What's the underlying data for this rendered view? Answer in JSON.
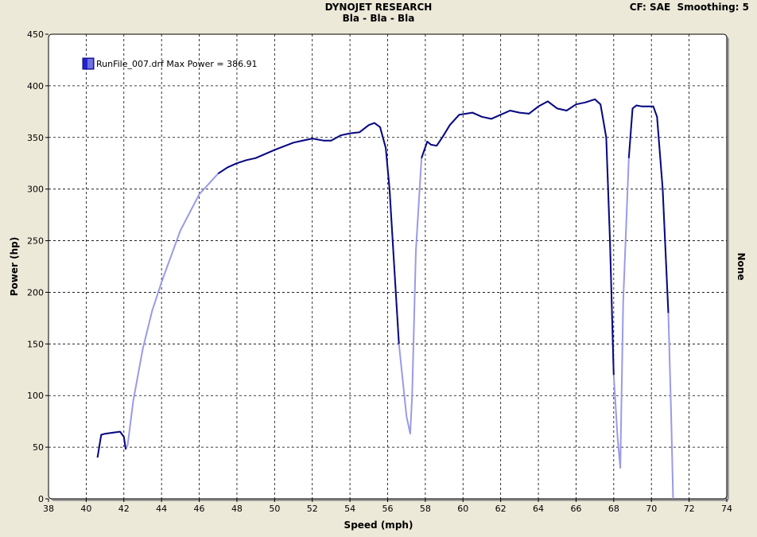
{
  "header": {
    "title": "DYNOJET RESEARCH",
    "subtitle": "Bla - Bla - Bla",
    "correction": "CF: SAE",
    "smoothing": "Smoothing: 5"
  },
  "right_label": "None",
  "chart_data": {
    "type": "line",
    "xlabel": "Speed (mph)",
    "ylabel": "Power (hp)",
    "xlim": [
      38,
      74
    ],
    "ylim": [
      0,
      450
    ],
    "xticks": [
      38,
      40,
      42,
      44,
      46,
      48,
      50,
      52,
      54,
      56,
      58,
      60,
      62,
      64,
      66,
      68,
      70,
      72,
      74
    ],
    "yticks": [
      0,
      50,
      100,
      150,
      200,
      250,
      300,
      350,
      400,
      450
    ],
    "grid": true,
    "legend_position": "top-left",
    "colors": {
      "line_dark": "#0a0a80",
      "line_light": "#9a9ae8",
      "plot_bg": "#ffffff",
      "window_bg": "#ece9d8"
    },
    "series": [
      {
        "name": "RunFile_007.drf Max Power = 386.91",
        "x": [
          40.6,
          40.8,
          41.0,
          41.4,
          41.8,
          42.0,
          42.1,
          42.2,
          42.5,
          43.0,
          43.5,
          44.0,
          45.0,
          46.0,
          47.0,
          47.5,
          48.0,
          48.5,
          49.0,
          50.0,
          51.0,
          52.0,
          52.6,
          53.0,
          53.5,
          54.0,
          54.5,
          55.0,
          55.3,
          55.6,
          55.9,
          56.1,
          56.3,
          56.6,
          57.0,
          57.2,
          57.3,
          57.5,
          57.8,
          58.1,
          58.3,
          58.6,
          58.9,
          59.3,
          59.8,
          60.5,
          61.0,
          61.5,
          62.0,
          62.5,
          63.0,
          63.5,
          64.0,
          64.5,
          65.0,
          65.5,
          66.0,
          66.5,
          67.0,
          67.3,
          67.6,
          67.8,
          68.0,
          68.2,
          68.35,
          68.5,
          68.8,
          69.0,
          69.2,
          69.5,
          69.8,
          70.1,
          70.3,
          70.6,
          70.9,
          71.05,
          71.15
        ],
        "y": [
          40,
          62,
          63,
          64,
          65,
          60,
          48,
          52,
          95,
          145,
          182,
          210,
          260,
          295,
          315,
          321,
          325,
          328,
          330,
          338,
          345,
          349,
          347,
          347,
          352,
          354,
          355,
          362,
          364,
          360,
          340,
          300,
          240,
          150,
          80,
          63,
          100,
          240,
          330,
          346,
          343,
          342,
          350,
          362,
          372,
          374,
          370,
          368,
          372,
          376,
          374,
          373,
          380,
          385,
          378,
          376,
          382,
          384,
          387,
          382,
          350,
          250,
          120,
          60,
          30,
          190,
          330,
          378,
          381,
          380,
          380,
          380,
          370,
          300,
          180,
          80,
          0
        ]
      }
    ]
  }
}
